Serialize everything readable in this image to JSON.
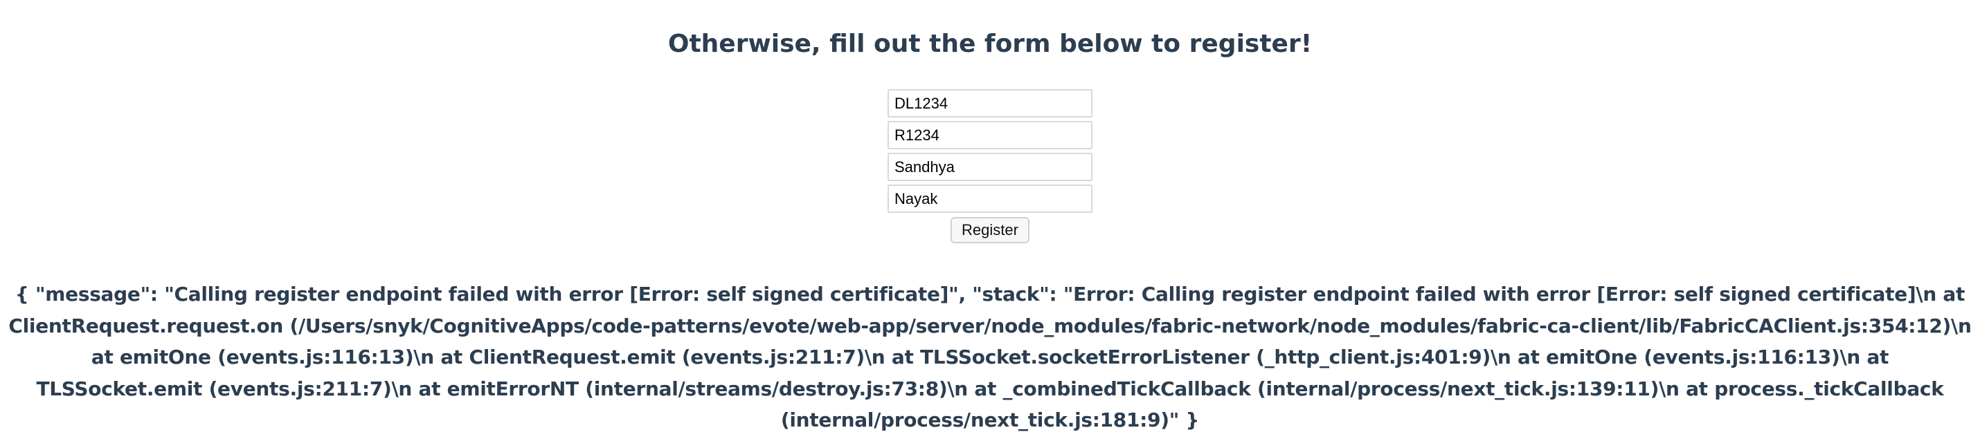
{
  "heading": "Otherwise, fill out the form below to register!",
  "form": {
    "fields": [
      {
        "name": "driver-license-field",
        "value": "DL1234"
      },
      {
        "name": "registration-field",
        "value": "R1234"
      },
      {
        "name": "first-name-field",
        "value": "Sandhya"
      },
      {
        "name": "last-name-field",
        "value": "Nayak"
      }
    ],
    "register_label": "Register"
  },
  "error_message": "{ \"message\": \"Calling register endpoint failed with error [Error: self signed certificate]\", \"stack\": \"Error: Calling register endpoint failed with error [Error: self signed certificate]\\n at ClientRequest.request.on (/Users/snyk/CognitiveApps/code-patterns/evote/web-app/server/node_modules/fabric-network/node_modules/fabric-ca-client/lib/FabricCAClient.js:354:12)\\n at emitOne (events.js:116:13)\\n at ClientRequest.emit (events.js:211:7)\\n at TLSSocket.socketErrorListener (_http_client.js:401:9)\\n at emitOne (events.js:116:13)\\n at TLSSocket.emit (events.js:211:7)\\n at emitErrorNT (internal/streams/destroy.js:73:8)\\n at _combinedTickCallback (internal/process/next_tick.js:139:11)\\n at process._tickCallback (internal/process/next_tick.js:181:9)\" }",
  "colors": {
    "text": "#2c3e50",
    "input_border": "#d9d9d9",
    "button_bg": "#f7f7f7"
  }
}
